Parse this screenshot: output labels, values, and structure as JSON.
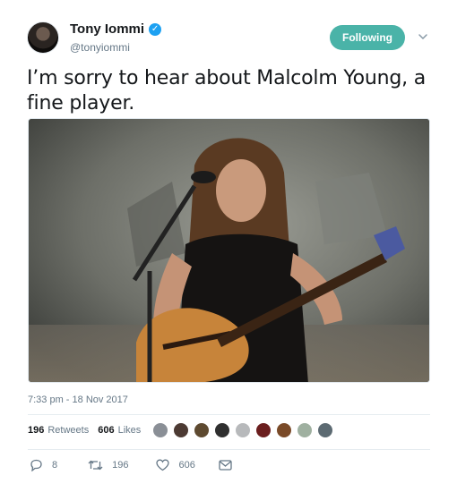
{
  "tweet": {
    "author": {
      "display_name": "Tony Iommi",
      "handle": "@tonyiommi",
      "verified_icon": "verified-badge-icon",
      "avatar_icon": "avatar"
    },
    "follow_button_label": "Following",
    "menu_icon": "chevron-down-icon",
    "text": "I’m sorry to hear about Malcolm Young, a fine player.",
    "media_icon": "photo-guitarist-on-stage",
    "timestamp": "7:33 pm - 18 Nov 2017",
    "stats": {
      "retweets_count": "196",
      "retweets_label": "Retweets",
      "likes_count": "606",
      "likes_label": "Likes"
    },
    "liker_avatars_count": 9,
    "actions": {
      "reply_count": "8",
      "retweet_count": "196",
      "like_count": "606"
    }
  },
  "colors": {
    "follow_button": "#4ab3a8",
    "verified": "#1da1f2",
    "secondary_text": "#657786"
  }
}
